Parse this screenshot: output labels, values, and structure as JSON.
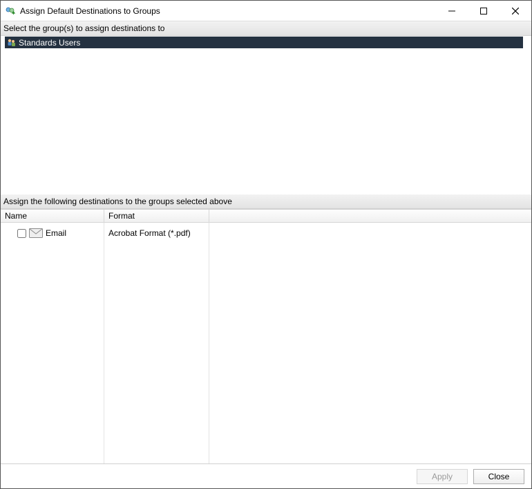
{
  "window": {
    "title": "Assign Default Destinations to Groups"
  },
  "sections": {
    "groups_label": "Select the group(s) to assign destinations to",
    "destinations_label": "Assign the following destinations to the groups selected above"
  },
  "groups": {
    "items": [
      {
        "label": "Standards Users",
        "selected": true
      }
    ]
  },
  "columns": {
    "name": "Name",
    "format": "Format"
  },
  "destinations": {
    "rows": [
      {
        "checked": false,
        "name": "Email",
        "format": "Acrobat Format (*.pdf)"
      }
    ]
  },
  "footer": {
    "apply": "Apply",
    "close": "Close",
    "apply_enabled": false
  }
}
